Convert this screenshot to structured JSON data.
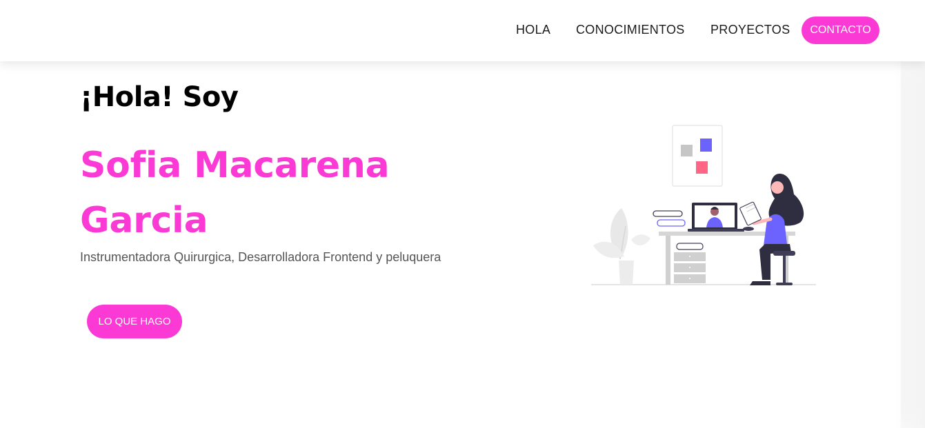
{
  "nav": {
    "links": [
      "HOLA",
      "CONOCIMIENTOS",
      "PROYECTOS"
    ],
    "contact_label": "CONTACTO"
  },
  "hero": {
    "greeting": "¡Hola! Soy",
    "name": "Sofia Macarena Garcia",
    "subtitle": "Instrumentadora Quirurgica, Desarrolladora Frontend y peluquera",
    "cta_label": "LO QUE HAGO",
    "illustration_icon": "person-at-desk-illustration"
  },
  "colors": {
    "accent": "#fb3ad6",
    "illustration_purple": "#6c63ff",
    "illustration_red": "#ff6584",
    "illustration_dark": "#2f2e41"
  }
}
